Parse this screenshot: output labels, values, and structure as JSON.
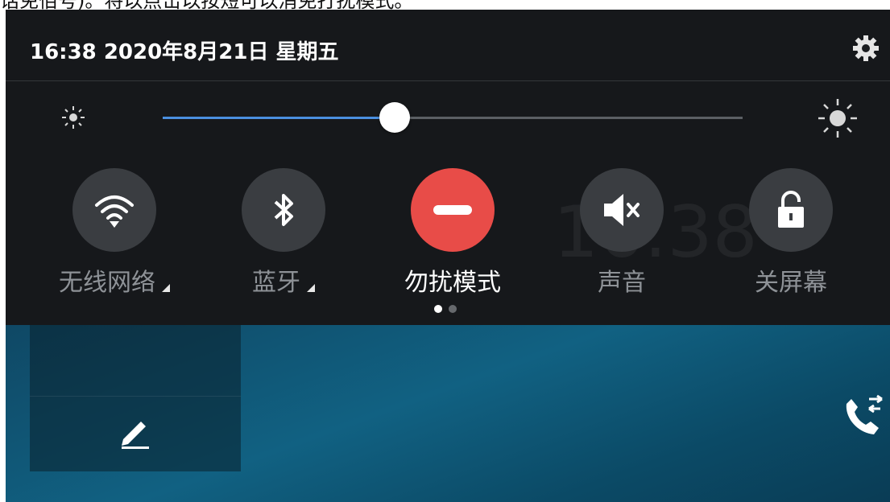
{
  "caption": {
    "text": "话免佰号)。将以点击以按短可以消免打扰模式。"
  },
  "status": {
    "datetime": "16:38 2020年8月21日 星期五",
    "settings_icon": "gear-icon"
  },
  "brightness": {
    "level_percent": 40,
    "min_icon": "sun-small-icon",
    "max_icon": "sun-large-icon"
  },
  "tiles": [
    {
      "label": "无线网络",
      "icon": "wifi-icon",
      "active": false,
      "expandable": true
    },
    {
      "label": "蓝牙",
      "icon": "bluetooth-icon",
      "active": false,
      "expandable": true
    },
    {
      "label": "勿扰模式",
      "icon": "do-not-disturb-icon",
      "active": true,
      "expandable": false
    },
    {
      "label": "声音",
      "icon": "volume-mute-icon",
      "active": false,
      "expandable": false
    },
    {
      "label": "关屏幕",
      "icon": "unlock-icon",
      "active": false,
      "expandable": false
    }
  ],
  "pager": {
    "pages": 2,
    "current": 1
  },
  "colors": {
    "accent": "#4a8fe0",
    "dnd_active": "#e84c48",
    "tile_bg": "#3a3d41",
    "panel_bg": "#16181b"
  }
}
